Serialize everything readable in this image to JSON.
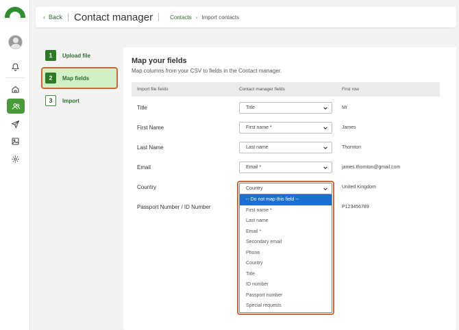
{
  "header": {
    "back_label": "Back",
    "title": "Contact manager",
    "breadcrumb": {
      "parent": "Contacts",
      "current": "Import contacts"
    }
  },
  "steps": [
    {
      "number": "1",
      "label": "Upload file"
    },
    {
      "number": "2",
      "label": "Map fields"
    },
    {
      "number": "3",
      "label": "Import"
    }
  ],
  "main": {
    "title": "Map your fields",
    "subtitle": "Map columns from your CSV to fields in the Contact manager.",
    "columns": [
      "Import file fields",
      "Contact manager fields",
      "First row"
    ],
    "rows": [
      {
        "field": "Title",
        "mapped": "Title",
        "first_row": "Mr"
      },
      {
        "field": "First Name",
        "mapped": "First name *",
        "first_row": "James"
      },
      {
        "field": "Last Name",
        "mapped": "Last name",
        "first_row": "Thornton"
      },
      {
        "field": "Email",
        "mapped": "Email *",
        "first_row": "james.thornton@gmail.com"
      },
      {
        "field": "Country",
        "mapped": "Country",
        "first_row": "United Kingdom"
      },
      {
        "field": "Passport Number / ID Number",
        "mapped": "",
        "first_row": "P123456789"
      }
    ],
    "dropdown_options": [
      "-- Do not map this field --",
      "First name *",
      "Last name",
      "Email *",
      "Secondary email",
      "Phone",
      "Country",
      "Title",
      "ID number",
      "Passport number",
      "Special requests"
    ],
    "highlighted_option": "-- Do not map this field --"
  },
  "colors": {
    "brand_green": "#2d7a24",
    "highlight_outline": "#c96a36",
    "active_step_bg": "#d2efc8",
    "option_highlight": "#1b6fd1"
  }
}
